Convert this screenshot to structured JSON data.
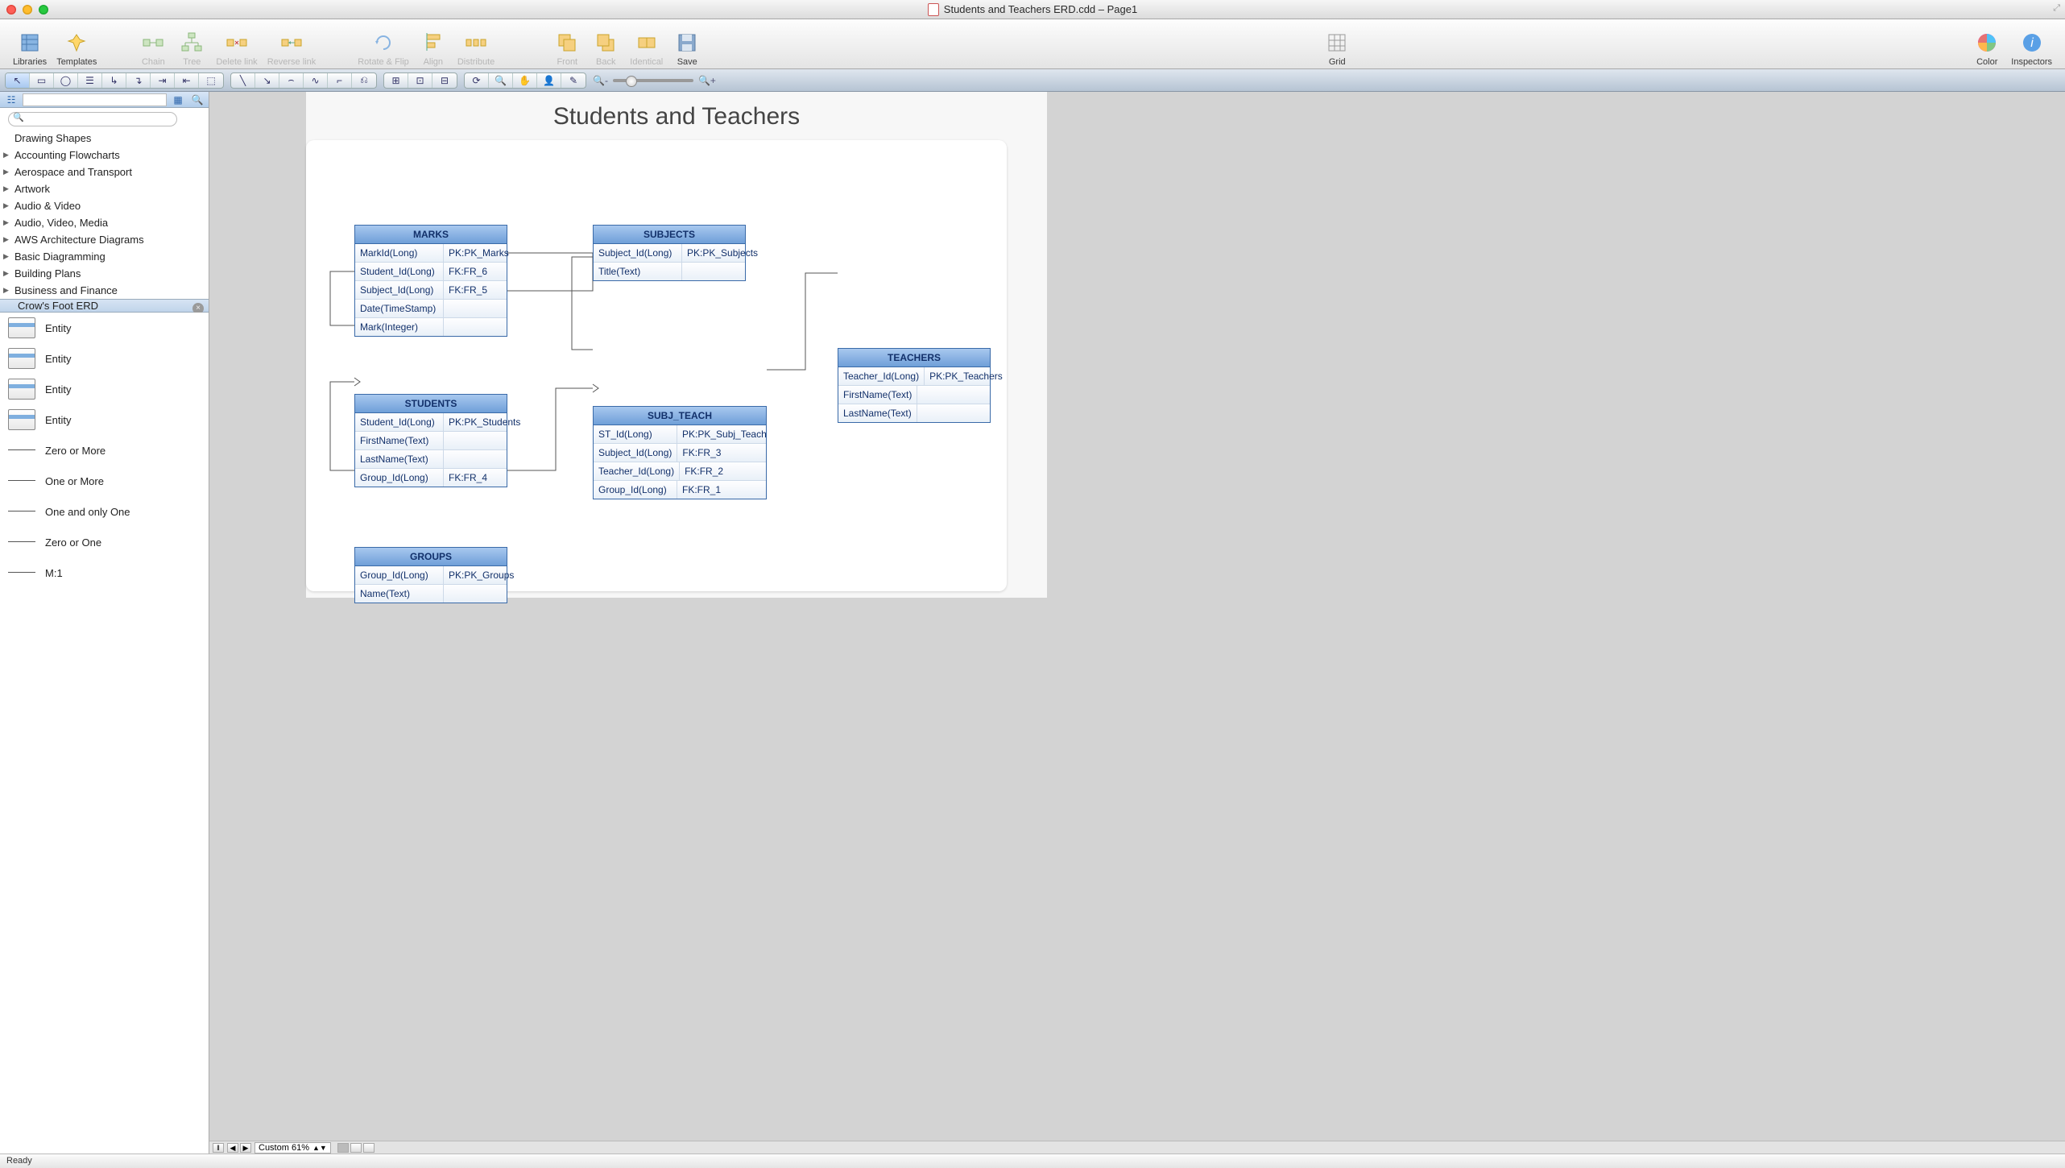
{
  "window": {
    "title": "Students and Teachers ERD.cdd – Page1"
  },
  "toolbar": {
    "libraries": "Libraries",
    "templates": "Templates",
    "chain": "Chain",
    "tree": "Tree",
    "deletelink": "Delete link",
    "reverselink": "Reverse link",
    "rotateflip": "Rotate & Flip",
    "align": "Align",
    "distribute": "Distribute",
    "front": "Front",
    "back": "Back",
    "identical": "Identical",
    "save": "Save",
    "grid": "Grid",
    "color": "Color",
    "inspectors": "Inspectors"
  },
  "sidebar": {
    "drawing_shapes": "Drawing Shapes",
    "categories": [
      "Accounting Flowcharts",
      "Aerospace and Transport",
      "Artwork",
      "Audio & Video",
      "Audio, Video, Media",
      "AWS Architecture Diagrams",
      "Basic Diagramming",
      "Building Plans",
      "Business and Finance"
    ],
    "selected_category": "Crow's Foot ERD",
    "shapes": [
      {
        "label": "Entity",
        "kind": "table"
      },
      {
        "label": "Entity",
        "kind": "table"
      },
      {
        "label": "Entity",
        "kind": "table"
      },
      {
        "label": "Entity",
        "kind": "table"
      },
      {
        "label": "Zero or More",
        "kind": "conn"
      },
      {
        "label": "One or More",
        "kind": "conn"
      },
      {
        "label": "One and only One",
        "kind": "conn"
      },
      {
        "label": "Zero or One",
        "kind": "conn"
      },
      {
        "label": "M:1",
        "kind": "conn"
      }
    ]
  },
  "diagram": {
    "title": "Students and Teachers",
    "entities": {
      "marks": {
        "name": "MARKS",
        "rows": [
          {
            "col": "MarkId(Long)",
            "key": "PK:PK_Marks"
          },
          {
            "col": "Student_Id(Long)",
            "key": "FK:FR_6"
          },
          {
            "col": "Subject_Id(Long)",
            "key": "FK:FR_5"
          },
          {
            "col": "Date(TimeStamp)",
            "key": ""
          },
          {
            "col": "Mark(Integer)",
            "key": ""
          }
        ]
      },
      "subjects": {
        "name": "SUBJECTS",
        "rows": [
          {
            "col": "Subject_Id(Long)",
            "key": "PK:PK_Subjects"
          },
          {
            "col": "Title(Text)",
            "key": ""
          }
        ]
      },
      "students": {
        "name": "STUDENTS",
        "rows": [
          {
            "col": "Student_Id(Long)",
            "key": "PK:PK_Students"
          },
          {
            "col": "FirstName(Text)",
            "key": ""
          },
          {
            "col": "LastName(Text)",
            "key": ""
          },
          {
            "col": "Group_Id(Long)",
            "key": "FK:FR_4"
          }
        ]
      },
      "subj_teach": {
        "name": "SUBJ_TEACH",
        "rows": [
          {
            "col": "ST_Id(Long)",
            "key": "PK:PK_Subj_Teach"
          },
          {
            "col": "Subject_Id(Long)",
            "key": "FK:FR_3"
          },
          {
            "col": "Teacher_Id(Long)",
            "key": "FK:FR_2"
          },
          {
            "col": "Group_Id(Long)",
            "key": "FK:FR_1"
          }
        ]
      },
      "teachers": {
        "name": "TEACHERS",
        "rows": [
          {
            "col": "Teacher_Id(Long)",
            "key": "PK:PK_Teachers"
          },
          {
            "col": "FirstName(Text)",
            "key": ""
          },
          {
            "col": "LastName(Text)",
            "key": ""
          }
        ]
      },
      "groups": {
        "name": "GROUPS",
        "rows": [
          {
            "col": "Group_Id(Long)",
            "key": "PK:PK_Groups"
          },
          {
            "col": "Name(Text)",
            "key": ""
          }
        ]
      }
    }
  },
  "footer": {
    "zoom_label": "Custom 61%"
  },
  "status": {
    "text": "Ready"
  }
}
